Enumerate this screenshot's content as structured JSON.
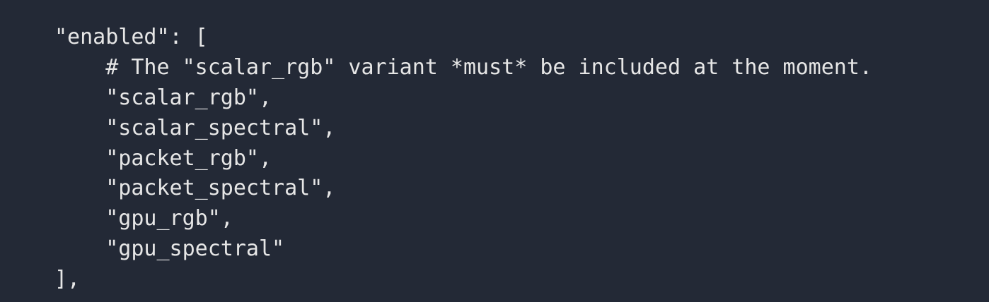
{
  "code_block": {
    "lines": [
      "\"enabled\": [",
      "    # The \"scalar_rgb\" variant *must* be included at the moment.",
      "    \"scalar_rgb\",",
      "    \"scalar_spectral\",",
      "    \"packet_rgb\",",
      "    \"packet_spectral\",",
      "    \"gpu_rgb\",",
      "    \"gpu_spectral\"",
      "],"
    ]
  },
  "colors": {
    "background": "#232936",
    "text": "#e6e6e6"
  }
}
